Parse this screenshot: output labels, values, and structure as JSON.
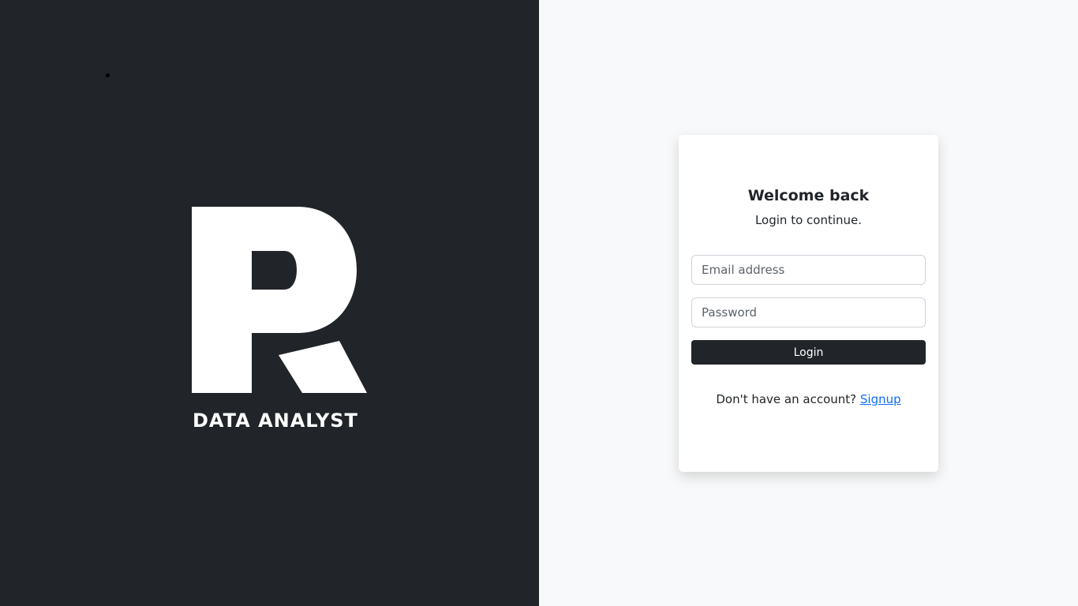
{
  "brand": {
    "logo_icon": "r-monogram-logo",
    "tagline": "DATA ANALYST"
  },
  "login_card": {
    "title": "Welcome back",
    "subtitle": "Login to continue.",
    "email_placeholder": "Email address",
    "email_value": "",
    "password_placeholder": "Password",
    "password_value": "",
    "login_label": "Login",
    "signup_prompt": "Don't have an account?",
    "signup_link": "Signup"
  },
  "colors": {
    "left_background": "#212529",
    "right_background": "#f8f9fa",
    "button": "#212529",
    "link": "#0d6efd"
  }
}
